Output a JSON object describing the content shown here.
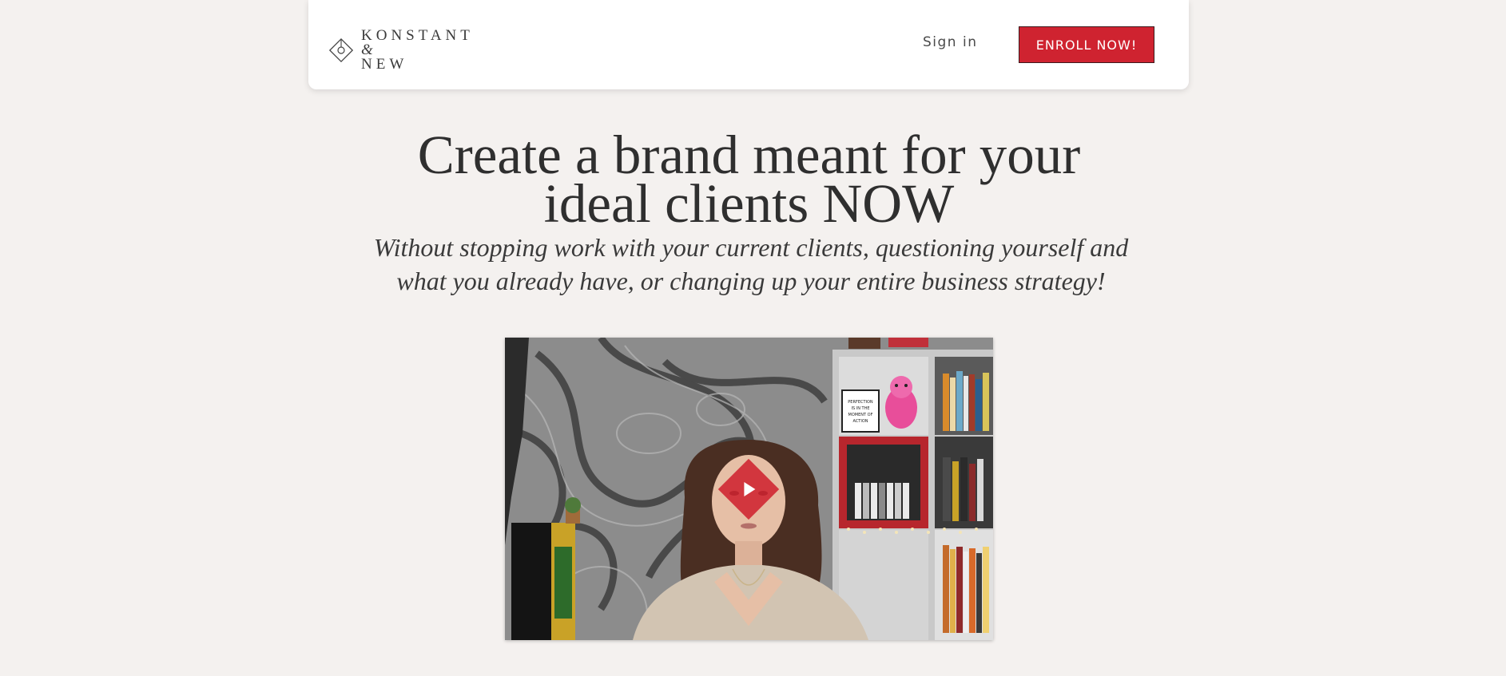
{
  "header": {
    "logo_line1": "KONSTANT",
    "logo_line2_amp": "&",
    "logo_line2_rest": " NEW",
    "signin_label": "Sign in",
    "enroll_label": "ENROLL NOW!"
  },
  "hero": {
    "headline_line1": "Create a brand meant for your",
    "headline_line2": "ideal clients NOW",
    "subhead_line1": "Without stopping work with your current clients, questioning yourself and",
    "subhead_line2": "what you already have, or changing up your entire business strategy!"
  },
  "video": {
    "sign_text_1": "PERFECTION",
    "sign_text_2": "IS IN THE",
    "sign_text_3": "MOMENT OF",
    "sign_text_4": "ACTION"
  },
  "colors": {
    "background": "#f4f1ef",
    "accent": "#cf2330",
    "text": "#2f2f2f"
  },
  "icons": {
    "logo": "diamond-logo-icon",
    "play": "play-icon"
  }
}
